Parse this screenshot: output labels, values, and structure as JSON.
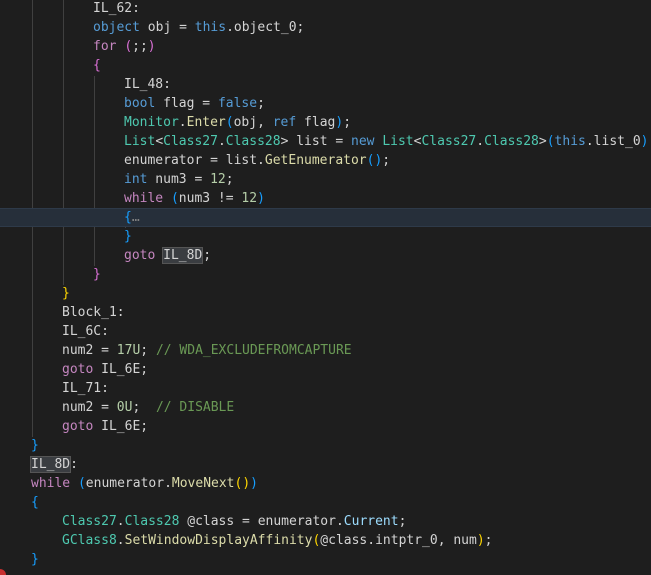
{
  "editor": {
    "colors": {
      "background": "#1e1e1e",
      "keyword": "#c586c0",
      "storage": "#569cd6",
      "type": "#4ec9b0",
      "function": "#dcdcaa",
      "variable": "#9cdcfe",
      "number": "#b5cea8",
      "comment": "#6a9955"
    },
    "lines": [
      {
        "indent": 3,
        "tokens": [
          {
            "t": "IL_62:",
            "c": "plain"
          }
        ]
      },
      {
        "indent": 3,
        "tokens": [
          {
            "t": "object",
            "c": "key"
          },
          {
            "t": " obj = ",
            "c": "plain"
          },
          {
            "t": "this",
            "c": "key"
          },
          {
            "t": ".object_0;",
            "c": "plain"
          }
        ]
      },
      {
        "indent": 3,
        "tokens": [
          {
            "t": "for",
            "c": "kw"
          },
          {
            "t": " ",
            "c": "plain"
          },
          {
            "t": "(",
            "c": "b2"
          },
          {
            "t": ";;",
            "c": "plain"
          },
          {
            "t": ")",
            "c": "b2"
          }
        ]
      },
      {
        "indent": 3,
        "tokens": [
          {
            "t": "{",
            "c": "b2"
          }
        ]
      },
      {
        "indent": 4,
        "tokens": [
          {
            "t": "IL_48:",
            "c": "plain"
          }
        ]
      },
      {
        "indent": 4,
        "tokens": [
          {
            "t": "bool",
            "c": "key"
          },
          {
            "t": " flag = ",
            "c": "plain"
          },
          {
            "t": "false",
            "c": "key"
          },
          {
            "t": ";",
            "c": "plain"
          }
        ]
      },
      {
        "indent": 4,
        "tokens": [
          {
            "t": "Monitor",
            "c": "type"
          },
          {
            "t": ".",
            "c": "plain"
          },
          {
            "t": "Enter",
            "c": "fn"
          },
          {
            "t": "(",
            "c": "b3"
          },
          {
            "t": "obj, ",
            "c": "plain"
          },
          {
            "t": "ref",
            "c": "key"
          },
          {
            "t": " flag",
            "c": "plain"
          },
          {
            "t": ")",
            "c": "b3"
          },
          {
            "t": ";",
            "c": "plain"
          }
        ]
      },
      {
        "indent": 4,
        "tokens": [
          {
            "t": "List",
            "c": "type"
          },
          {
            "t": "<",
            "c": "plain"
          },
          {
            "t": "Class27",
            "c": "type"
          },
          {
            "t": ".",
            "c": "plain"
          },
          {
            "t": "Class28",
            "c": "type"
          },
          {
            "t": "> list = ",
            "c": "plain"
          },
          {
            "t": "new",
            "c": "key"
          },
          {
            "t": " ",
            "c": "plain"
          },
          {
            "t": "List",
            "c": "type"
          },
          {
            "t": "<",
            "c": "plain"
          },
          {
            "t": "Class27",
            "c": "type"
          },
          {
            "t": ".",
            "c": "plain"
          },
          {
            "t": "Class28",
            "c": "type"
          },
          {
            "t": ">",
            "c": "plain"
          },
          {
            "t": "(",
            "c": "b3"
          },
          {
            "t": "this",
            "c": "key"
          },
          {
            "t": ".list_0",
            "c": "plain"
          },
          {
            "t": ")",
            "c": "b3"
          },
          {
            "t": ";",
            "c": "plain"
          }
        ]
      },
      {
        "indent": 4,
        "tokens": [
          {
            "t": "enumerator = list.",
            "c": "plain"
          },
          {
            "t": "GetEnumerator",
            "c": "fn"
          },
          {
            "t": "()",
            "c": "b3"
          },
          {
            "t": ";",
            "c": "plain"
          }
        ]
      },
      {
        "indent": 4,
        "tokens": [
          {
            "t": "int",
            "c": "key"
          },
          {
            "t": " num3 = ",
            "c": "plain"
          },
          {
            "t": "12",
            "c": "num"
          },
          {
            "t": ";",
            "c": "plain"
          }
        ]
      },
      {
        "indent": 4,
        "tokens": [
          {
            "t": "while",
            "c": "kw"
          },
          {
            "t": " ",
            "c": "plain"
          },
          {
            "t": "(",
            "c": "b3"
          },
          {
            "t": "num3 != ",
            "c": "plain"
          },
          {
            "t": "12",
            "c": "num"
          },
          {
            "t": ")",
            "c": "b3"
          }
        ]
      },
      {
        "indent": 4,
        "current": true,
        "tokens": [
          {
            "t": "{",
            "c": "b3"
          },
          {
            "t": "…",
            "c": "fold"
          }
        ]
      },
      {
        "indent": 4,
        "tokens": [
          {
            "t": "}",
            "c": "b3"
          }
        ]
      },
      {
        "indent": 4,
        "tokens": [
          {
            "t": "goto",
            "c": "kw"
          },
          {
            "t": " ",
            "c": "plain"
          },
          {
            "t": "IL_8D",
            "c": "hl"
          },
          {
            "t": ";",
            "c": "cursor"
          }
        ]
      },
      {
        "indent": 3,
        "tokens": [
          {
            "t": "}",
            "c": "b2"
          }
        ]
      },
      {
        "indent": 2,
        "tokens": [
          {
            "t": "}",
            "c": "b1"
          }
        ]
      },
      {
        "indent": 2,
        "tokens": [
          {
            "t": "Block_1:",
            "c": "plain"
          }
        ]
      },
      {
        "indent": 2,
        "tokens": [
          {
            "t": "IL_6C:",
            "c": "plain"
          }
        ]
      },
      {
        "indent": 2,
        "tokens": [
          {
            "t": "num2 = ",
            "c": "plain"
          },
          {
            "t": "17U",
            "c": "num"
          },
          {
            "t": "; ",
            "c": "plain"
          },
          {
            "t": "// WDA_EXCLUDEFROMCAPTURE",
            "c": "cm"
          }
        ]
      },
      {
        "indent": 2,
        "tokens": [
          {
            "t": "goto",
            "c": "kw"
          },
          {
            "t": " IL_6E;",
            "c": "plain"
          }
        ]
      },
      {
        "indent": 2,
        "tokens": [
          {
            "t": "IL_71:",
            "c": "plain"
          }
        ]
      },
      {
        "indent": 2,
        "tokens": [
          {
            "t": "num2 = ",
            "c": "plain"
          },
          {
            "t": "0U",
            "c": "num"
          },
          {
            "t": ";  ",
            "c": "plain"
          },
          {
            "t": "// DISABLE",
            "c": "cm"
          }
        ]
      },
      {
        "indent": 2,
        "tokens": [
          {
            "t": "goto",
            "c": "kw"
          },
          {
            "t": " IL_6E;",
            "c": "plain"
          }
        ]
      },
      {
        "indent": 1,
        "tokens": [
          {
            "t": "}",
            "c": "b3"
          }
        ]
      },
      {
        "indent": 1,
        "tokens": [
          {
            "t": "IL_8D",
            "c": "hl"
          },
          {
            "t": ":",
            "c": "plain"
          }
        ]
      },
      {
        "indent": 1,
        "tokens": [
          {
            "t": "while",
            "c": "kw"
          },
          {
            "t": " ",
            "c": "plain"
          },
          {
            "t": "(",
            "c": "b3"
          },
          {
            "t": "enumerator.",
            "c": "plain"
          },
          {
            "t": "MoveNext",
            "c": "fn"
          },
          {
            "t": "()",
            "c": "b1"
          },
          {
            "t": ")",
            "c": "b3"
          }
        ]
      },
      {
        "indent": 1,
        "tokens": [
          {
            "t": "{",
            "c": "b3"
          }
        ]
      },
      {
        "indent": 2,
        "tokens": [
          {
            "t": "Class27",
            "c": "type"
          },
          {
            "t": ".",
            "c": "plain"
          },
          {
            "t": "Class28",
            "c": "type"
          },
          {
            "t": " @class = enumerator.",
            "c": "plain"
          },
          {
            "t": "Current",
            "c": "var"
          },
          {
            "t": ";",
            "c": "plain"
          }
        ]
      },
      {
        "indent": 2,
        "tokens": [
          {
            "t": "GClass8",
            "c": "type"
          },
          {
            "t": ".",
            "c": "plain"
          },
          {
            "t": "SetWindowDisplayAffinity",
            "c": "fn"
          },
          {
            "t": "(",
            "c": "b1"
          },
          {
            "t": "@class.intptr_0, num",
            "c": "plain"
          },
          {
            "t": ")",
            "c": "b1"
          },
          {
            "t": ";",
            "c": "plain"
          }
        ]
      },
      {
        "indent": 1,
        "tokens": [
          {
            "t": "}",
            "c": "b3"
          }
        ]
      }
    ]
  }
}
